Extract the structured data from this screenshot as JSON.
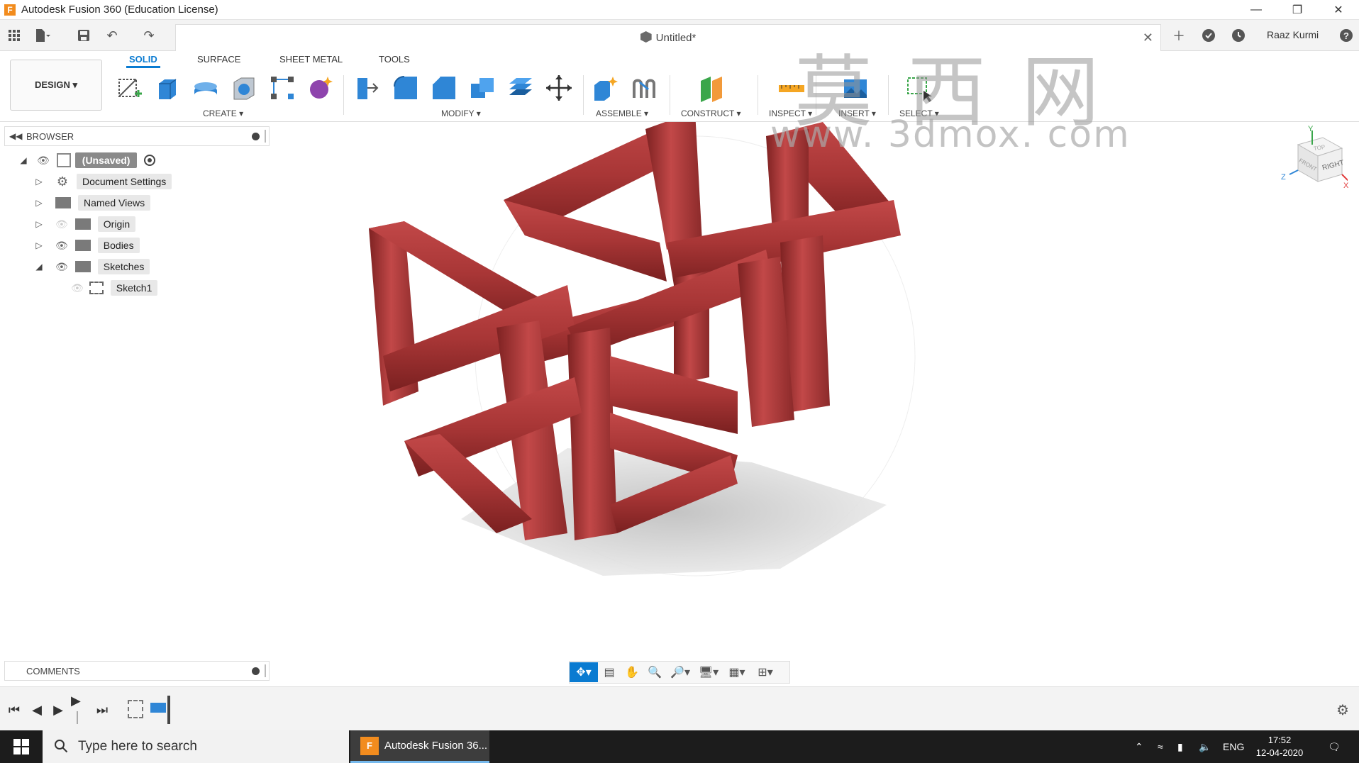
{
  "window": {
    "title": "Autodesk Fusion 360 (Education License)",
    "app_icon_letter": "F"
  },
  "document": {
    "title": "Untitled*",
    "user": "Raaz Kurmi"
  },
  "ribbon": {
    "workspace": "DESIGN ▾",
    "tabs": [
      "SOLID",
      "SURFACE",
      "SHEET METAL",
      "TOOLS"
    ],
    "active_tab": "SOLID",
    "groups": {
      "create": "CREATE ▾",
      "modify": "MODIFY ▾",
      "assemble": "ASSEMBLE ▾",
      "construct": "CONSTRUCT ▾",
      "inspect": "INSPECT ▾",
      "insert": "INSERT ▾",
      "select": "SELECT ▾"
    }
  },
  "browser": {
    "header": "BROWSER",
    "root": "(Unsaved)",
    "items": [
      {
        "label": "Document Settings",
        "icon": "gear-icon"
      },
      {
        "label": "Named Views",
        "icon": "folder-icon"
      },
      {
        "label": "Origin",
        "icon": "folder-icon"
      },
      {
        "label": "Bodies",
        "icon": "folder-icon"
      },
      {
        "label": "Sketches",
        "icon": "folder-icon"
      },
      {
        "label": "Sketch1",
        "icon": "sketch-icon"
      }
    ]
  },
  "comments": {
    "header": "COMMENTS"
  },
  "viewcube": {
    "face_right": "RIGHT",
    "face_front": "FRONT",
    "face_top": "TOP",
    "axis_x": "X",
    "axis_y": "Y",
    "axis_z": "Z"
  },
  "watermark": {
    "text": "www. 3dmox. com",
    "chinese": "莫西网"
  },
  "taskbar": {
    "search_placeholder": "Type here to search",
    "running_app": "Autodesk Fusion 36...",
    "language": "ENG",
    "time": "17:52",
    "date": "12-04-2020"
  },
  "colors": {
    "accent": "#0a7bd1",
    "model_red": "#b33a3a"
  }
}
